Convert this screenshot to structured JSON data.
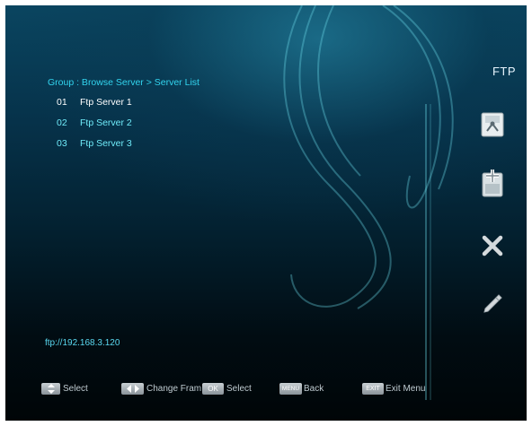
{
  "header": {
    "title": "FTP"
  },
  "breadcrumb": "Group : Browse Server > Server List",
  "servers": [
    {
      "num": "01",
      "name": "Ftp Server 1",
      "selected": true
    },
    {
      "num": "02",
      "name": "Ftp Server 2",
      "selected": false
    },
    {
      "num": "03",
      "name": "Ftp Server 3",
      "selected": false
    }
  ],
  "side_actions": [
    "connect-icon",
    "add-icon",
    "delete-icon",
    "edit-icon"
  ],
  "ftp_address": "ftp://192.168.3.120",
  "help": {
    "select_label": "Select",
    "change_frame_label": "Change Fram",
    "ok_key": "OK",
    "ok_label": "Select",
    "menu_key": "MENU",
    "back_label": "Back",
    "exit_key": "EXIT",
    "exit_label": "Exit Menu"
  },
  "colors": {
    "accent": "#32d4ee",
    "list_text": "#6feaf8",
    "selected_text": "#ffffff"
  }
}
